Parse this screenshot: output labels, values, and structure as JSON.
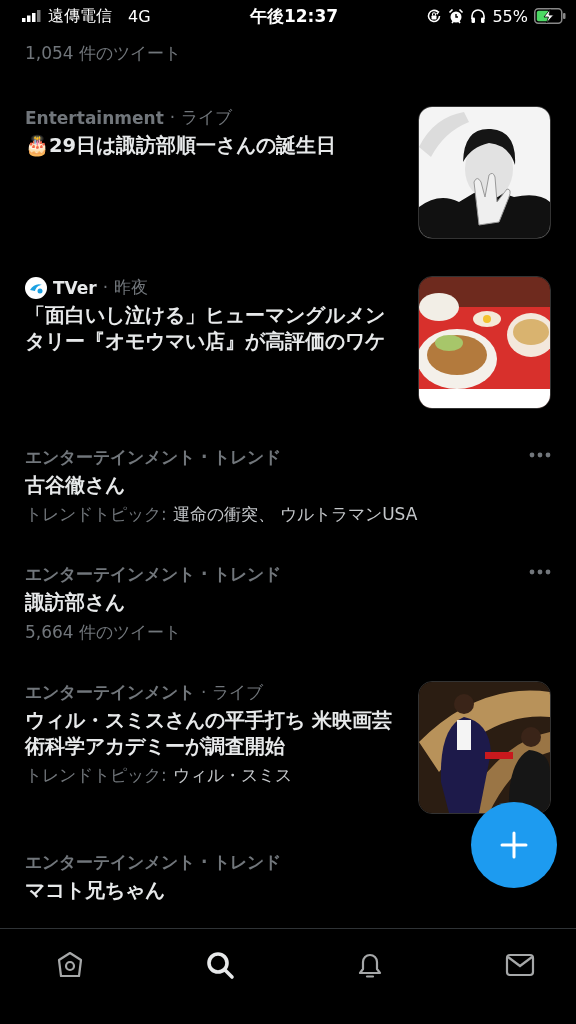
{
  "status_bar": {
    "carrier": "遠傳電信",
    "network": "4G",
    "time": "午後12:37",
    "battery": "55%"
  },
  "lead": {
    "count": "1,054 件のツイート"
  },
  "trends": [
    {
      "kind": "label",
      "category": "Entertainment",
      "meta": "· ライブ",
      "title": "🎂29日は諏訪部順一さんの誕生日",
      "more": false
    },
    {
      "kind": "publisher",
      "category": "TVer",
      "meta": "· 昨夜",
      "title": "「面白いし泣ける」ヒューマングルメンタリー『オモウマい店』が高評価のワケ",
      "more": false
    },
    {
      "kind": "label",
      "category": "エンターテインメント · トレンド",
      "title": "古谷徹さん",
      "topics": {
        "label": "トレンドトピック:",
        "value": "運命の衝突、 ウルトラマンUSA"
      },
      "more": true
    },
    {
      "kind": "label",
      "category": "エンターテインメント · トレンド",
      "title": "諏訪部さん",
      "count": "5,664 件のツイート",
      "more": true
    },
    {
      "kind": "label",
      "category": "エンターテインメント",
      "meta": "· ライブ",
      "title": "ウィル・スミスさんの平手打ち 米映画芸術科学アカデミーが調査開始",
      "topics": {
        "label": "トレンドトピック:",
        "value": "ウィル・スミス"
      },
      "more": false
    },
    {
      "kind": "label",
      "category": "エンターテインメント · トレンド",
      "title": "マコト兄ちゃん"
    }
  ],
  "tabs": [
    {
      "selected": false
    },
    {
      "selected": true
    },
    {
      "selected": false
    },
    {
      "selected": false
    }
  ]
}
